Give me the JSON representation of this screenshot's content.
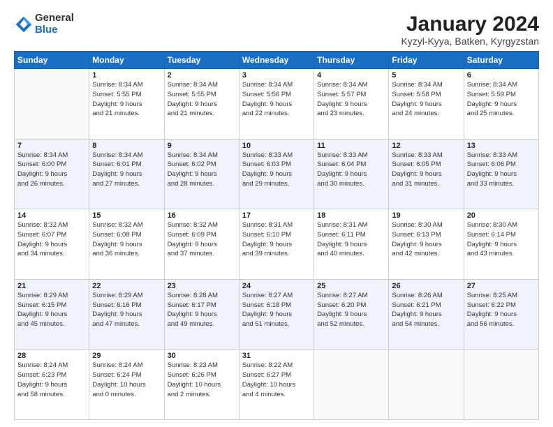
{
  "header": {
    "logo_general": "General",
    "logo_blue": "Blue",
    "title": "January 2024",
    "subtitle": "Kyzyl-Kyya, Batken, Kyrgyzstan"
  },
  "weekdays": [
    "Sunday",
    "Monday",
    "Tuesday",
    "Wednesday",
    "Thursday",
    "Friday",
    "Saturday"
  ],
  "weeks": [
    [
      {
        "day": "",
        "info": ""
      },
      {
        "day": "1",
        "info": "Sunrise: 8:34 AM\nSunset: 5:55 PM\nDaylight: 9 hours\nand 21 minutes."
      },
      {
        "day": "2",
        "info": "Sunrise: 8:34 AM\nSunset: 5:55 PM\nDaylight: 9 hours\nand 21 minutes."
      },
      {
        "day": "3",
        "info": "Sunrise: 8:34 AM\nSunset: 5:56 PM\nDaylight: 9 hours\nand 22 minutes."
      },
      {
        "day": "4",
        "info": "Sunrise: 8:34 AM\nSunset: 5:57 PM\nDaylight: 9 hours\nand 23 minutes."
      },
      {
        "day": "5",
        "info": "Sunrise: 8:34 AM\nSunset: 5:58 PM\nDaylight: 9 hours\nand 24 minutes."
      },
      {
        "day": "6",
        "info": "Sunrise: 8:34 AM\nSunset: 5:59 PM\nDaylight: 9 hours\nand 25 minutes."
      }
    ],
    [
      {
        "day": "7",
        "info": "Sunrise: 8:34 AM\nSunset: 6:00 PM\nDaylight: 9 hours\nand 26 minutes."
      },
      {
        "day": "8",
        "info": "Sunrise: 8:34 AM\nSunset: 6:01 PM\nDaylight: 9 hours\nand 27 minutes."
      },
      {
        "day": "9",
        "info": "Sunrise: 8:34 AM\nSunset: 6:02 PM\nDaylight: 9 hours\nand 28 minutes."
      },
      {
        "day": "10",
        "info": "Sunrise: 8:33 AM\nSunset: 6:03 PM\nDaylight: 9 hours\nand 29 minutes."
      },
      {
        "day": "11",
        "info": "Sunrise: 8:33 AM\nSunset: 6:04 PM\nDaylight: 9 hours\nand 30 minutes."
      },
      {
        "day": "12",
        "info": "Sunrise: 8:33 AM\nSunset: 6:05 PM\nDaylight: 9 hours\nand 31 minutes."
      },
      {
        "day": "13",
        "info": "Sunrise: 8:33 AM\nSunset: 6:06 PM\nDaylight: 9 hours\nand 33 minutes."
      }
    ],
    [
      {
        "day": "14",
        "info": "Sunrise: 8:32 AM\nSunset: 6:07 PM\nDaylight: 9 hours\nand 34 minutes."
      },
      {
        "day": "15",
        "info": "Sunrise: 8:32 AM\nSunset: 6:08 PM\nDaylight: 9 hours\nand 36 minutes."
      },
      {
        "day": "16",
        "info": "Sunrise: 8:32 AM\nSunset: 6:09 PM\nDaylight: 9 hours\nand 37 minutes."
      },
      {
        "day": "17",
        "info": "Sunrise: 8:31 AM\nSunset: 6:10 PM\nDaylight: 9 hours\nand 39 minutes."
      },
      {
        "day": "18",
        "info": "Sunrise: 8:31 AM\nSunset: 6:11 PM\nDaylight: 9 hours\nand 40 minutes."
      },
      {
        "day": "19",
        "info": "Sunrise: 8:30 AM\nSunset: 6:13 PM\nDaylight: 9 hours\nand 42 minutes."
      },
      {
        "day": "20",
        "info": "Sunrise: 8:30 AM\nSunset: 6:14 PM\nDaylight: 9 hours\nand 43 minutes."
      }
    ],
    [
      {
        "day": "21",
        "info": "Sunrise: 8:29 AM\nSunset: 6:15 PM\nDaylight: 9 hours\nand 45 minutes."
      },
      {
        "day": "22",
        "info": "Sunrise: 8:29 AM\nSunset: 6:16 PM\nDaylight: 9 hours\nand 47 minutes."
      },
      {
        "day": "23",
        "info": "Sunrise: 8:28 AM\nSunset: 6:17 PM\nDaylight: 9 hours\nand 49 minutes."
      },
      {
        "day": "24",
        "info": "Sunrise: 8:27 AM\nSunset: 6:18 PM\nDaylight: 9 hours\nand 51 minutes."
      },
      {
        "day": "25",
        "info": "Sunrise: 8:27 AM\nSunset: 6:20 PM\nDaylight: 9 hours\nand 52 minutes."
      },
      {
        "day": "26",
        "info": "Sunrise: 8:26 AM\nSunset: 6:21 PM\nDaylight: 9 hours\nand 54 minutes."
      },
      {
        "day": "27",
        "info": "Sunrise: 8:25 AM\nSunset: 6:22 PM\nDaylight: 9 hours\nand 56 minutes."
      }
    ],
    [
      {
        "day": "28",
        "info": "Sunrise: 8:24 AM\nSunset: 6:23 PM\nDaylight: 9 hours\nand 58 minutes."
      },
      {
        "day": "29",
        "info": "Sunrise: 8:24 AM\nSunset: 6:24 PM\nDaylight: 10 hours\nand 0 minutes."
      },
      {
        "day": "30",
        "info": "Sunrise: 8:23 AM\nSunset: 6:26 PM\nDaylight: 10 hours\nand 2 minutes."
      },
      {
        "day": "31",
        "info": "Sunrise: 8:22 AM\nSunset: 6:27 PM\nDaylight: 10 hours\nand 4 minutes."
      },
      {
        "day": "",
        "info": ""
      },
      {
        "day": "",
        "info": ""
      },
      {
        "day": "",
        "info": ""
      }
    ]
  ]
}
